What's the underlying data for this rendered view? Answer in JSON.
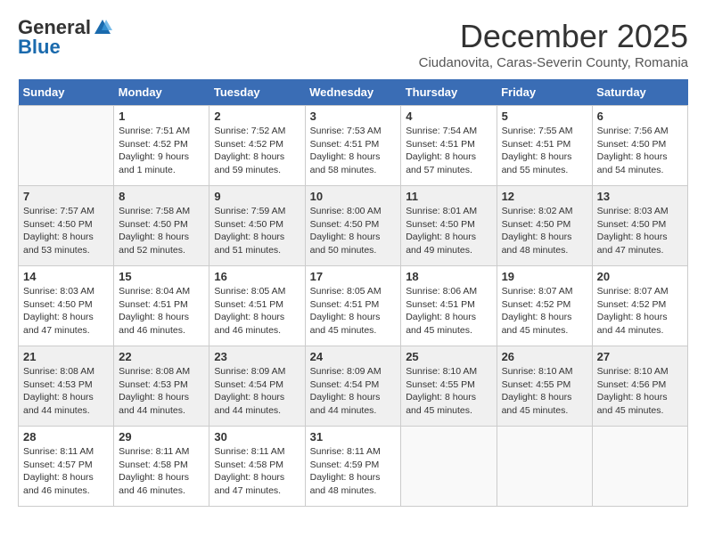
{
  "logo": {
    "general": "General",
    "blue": "Blue"
  },
  "title": "December 2025",
  "location": "Ciudanovita, Caras-Severin County, Romania",
  "days_of_week": [
    "Sunday",
    "Monday",
    "Tuesday",
    "Wednesday",
    "Thursday",
    "Friday",
    "Saturday"
  ],
  "weeks": [
    [
      {
        "day": "",
        "info": ""
      },
      {
        "day": "1",
        "info": "Sunrise: 7:51 AM\nSunset: 4:52 PM\nDaylight: 9 hours\nand 1 minute."
      },
      {
        "day": "2",
        "info": "Sunrise: 7:52 AM\nSunset: 4:52 PM\nDaylight: 8 hours\nand 59 minutes."
      },
      {
        "day": "3",
        "info": "Sunrise: 7:53 AM\nSunset: 4:51 PM\nDaylight: 8 hours\nand 58 minutes."
      },
      {
        "day": "4",
        "info": "Sunrise: 7:54 AM\nSunset: 4:51 PM\nDaylight: 8 hours\nand 57 minutes."
      },
      {
        "day": "5",
        "info": "Sunrise: 7:55 AM\nSunset: 4:51 PM\nDaylight: 8 hours\nand 55 minutes."
      },
      {
        "day": "6",
        "info": "Sunrise: 7:56 AM\nSunset: 4:50 PM\nDaylight: 8 hours\nand 54 minutes."
      }
    ],
    [
      {
        "day": "7",
        "info": "Sunrise: 7:57 AM\nSunset: 4:50 PM\nDaylight: 8 hours\nand 53 minutes."
      },
      {
        "day": "8",
        "info": "Sunrise: 7:58 AM\nSunset: 4:50 PM\nDaylight: 8 hours\nand 52 minutes."
      },
      {
        "day": "9",
        "info": "Sunrise: 7:59 AM\nSunset: 4:50 PM\nDaylight: 8 hours\nand 51 minutes."
      },
      {
        "day": "10",
        "info": "Sunrise: 8:00 AM\nSunset: 4:50 PM\nDaylight: 8 hours\nand 50 minutes."
      },
      {
        "day": "11",
        "info": "Sunrise: 8:01 AM\nSunset: 4:50 PM\nDaylight: 8 hours\nand 49 minutes."
      },
      {
        "day": "12",
        "info": "Sunrise: 8:02 AM\nSunset: 4:50 PM\nDaylight: 8 hours\nand 48 minutes."
      },
      {
        "day": "13",
        "info": "Sunrise: 8:03 AM\nSunset: 4:50 PM\nDaylight: 8 hours\nand 47 minutes."
      }
    ],
    [
      {
        "day": "14",
        "info": "Sunrise: 8:03 AM\nSunset: 4:50 PM\nDaylight: 8 hours\nand 47 minutes."
      },
      {
        "day": "15",
        "info": "Sunrise: 8:04 AM\nSunset: 4:51 PM\nDaylight: 8 hours\nand 46 minutes."
      },
      {
        "day": "16",
        "info": "Sunrise: 8:05 AM\nSunset: 4:51 PM\nDaylight: 8 hours\nand 46 minutes."
      },
      {
        "day": "17",
        "info": "Sunrise: 8:05 AM\nSunset: 4:51 PM\nDaylight: 8 hours\nand 45 minutes."
      },
      {
        "day": "18",
        "info": "Sunrise: 8:06 AM\nSunset: 4:51 PM\nDaylight: 8 hours\nand 45 minutes."
      },
      {
        "day": "19",
        "info": "Sunrise: 8:07 AM\nSunset: 4:52 PM\nDaylight: 8 hours\nand 45 minutes."
      },
      {
        "day": "20",
        "info": "Sunrise: 8:07 AM\nSunset: 4:52 PM\nDaylight: 8 hours\nand 44 minutes."
      }
    ],
    [
      {
        "day": "21",
        "info": "Sunrise: 8:08 AM\nSunset: 4:53 PM\nDaylight: 8 hours\nand 44 minutes."
      },
      {
        "day": "22",
        "info": "Sunrise: 8:08 AM\nSunset: 4:53 PM\nDaylight: 8 hours\nand 44 minutes."
      },
      {
        "day": "23",
        "info": "Sunrise: 8:09 AM\nSunset: 4:54 PM\nDaylight: 8 hours\nand 44 minutes."
      },
      {
        "day": "24",
        "info": "Sunrise: 8:09 AM\nSunset: 4:54 PM\nDaylight: 8 hours\nand 44 minutes."
      },
      {
        "day": "25",
        "info": "Sunrise: 8:10 AM\nSunset: 4:55 PM\nDaylight: 8 hours\nand 45 minutes."
      },
      {
        "day": "26",
        "info": "Sunrise: 8:10 AM\nSunset: 4:55 PM\nDaylight: 8 hours\nand 45 minutes."
      },
      {
        "day": "27",
        "info": "Sunrise: 8:10 AM\nSunset: 4:56 PM\nDaylight: 8 hours\nand 45 minutes."
      }
    ],
    [
      {
        "day": "28",
        "info": "Sunrise: 8:11 AM\nSunset: 4:57 PM\nDaylight: 8 hours\nand 46 minutes."
      },
      {
        "day": "29",
        "info": "Sunrise: 8:11 AM\nSunset: 4:58 PM\nDaylight: 8 hours\nand 46 minutes."
      },
      {
        "day": "30",
        "info": "Sunrise: 8:11 AM\nSunset: 4:58 PM\nDaylight: 8 hours\nand 47 minutes."
      },
      {
        "day": "31",
        "info": "Sunrise: 8:11 AM\nSunset: 4:59 PM\nDaylight: 8 hours\nand 48 minutes."
      },
      {
        "day": "",
        "info": ""
      },
      {
        "day": "",
        "info": ""
      },
      {
        "day": "",
        "info": ""
      }
    ]
  ]
}
